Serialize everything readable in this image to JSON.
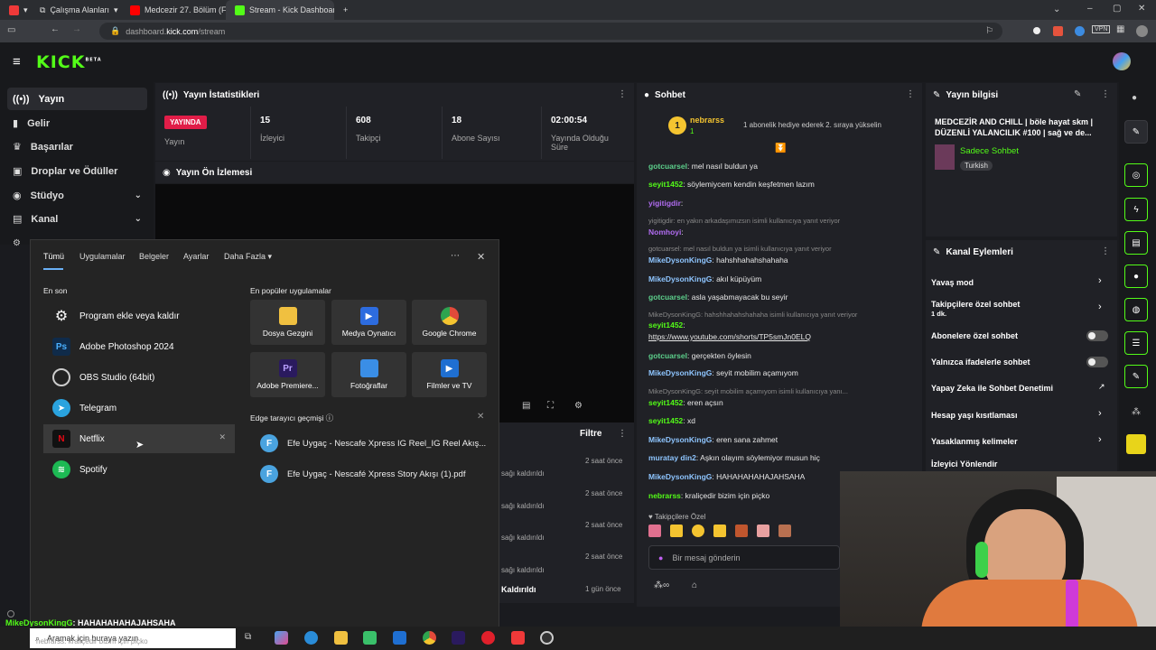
{
  "browser": {
    "tabs": [
      {
        "label": "Çalışma Alanları",
        "icon": "workspace-icon"
      },
      {
        "label": "Medcezir 27. Bölüm (FULL H",
        "icon": "youtube-icon"
      },
      {
        "label": "Stream - Kick Dashboard",
        "icon": "kick-icon"
      }
    ],
    "url_prefix": "dashboard.",
    "url_domain": "kick.com",
    "url_path": "/stream"
  },
  "kick": {
    "logo": "KICK",
    "logo_badge": "BETA"
  },
  "sidebar": {
    "items": [
      {
        "label": "Yayın"
      },
      {
        "label": "Gelir"
      },
      {
        "label": "Başarılar"
      },
      {
        "label": "Droplar ve Ödüller"
      },
      {
        "label": "Stüdyo"
      },
      {
        "label": "Kanal"
      }
    ]
  },
  "stats": {
    "title": "Yayın İstatistikleri",
    "live_badge": "YAYINDA",
    "live_label": "Yayın",
    "viewers": "15",
    "viewers_label": "İzleyici",
    "followers": "608",
    "followers_label": "Takipçi",
    "subs": "18",
    "subs_label": "Abone Sayısı",
    "duration": "02:00:54",
    "duration_label": "Yayında Olduğu Süre"
  },
  "preview": {
    "title": "Yayın Ön İzlemesi"
  },
  "activity": {
    "filter": "Filtre",
    "rows": [
      {
        "text": "sağı kaldırıldı",
        "time": "2 saat önce"
      },
      {
        "text": "sağı kaldırıldı",
        "time": "2 saat önce"
      },
      {
        "text": "sağı kaldırıldı",
        "time": "2 saat önce"
      },
      {
        "text": "sağı kaldırıldı",
        "time": "2 saat önce"
      },
      {
        "text": "Kaldırıldı",
        "time": "1 gün önce"
      }
    ]
  },
  "chat": {
    "title": "Sohbet",
    "pinned_user": "nebrarss",
    "pinned_count": "1",
    "pinned_text": "1 abonelik hediye ederek 2. sıraya yükselin",
    "messages": [
      {
        "user": "gotcuarsel",
        "text": "mel nasıl buldun ya",
        "color": "#5ccf8b"
      },
      {
        "user": "seyit1452",
        "text": "söylemiycem kendin keşfetmen lazım",
        "color": "#53fc18"
      },
      {
        "user": "yigitigdir",
        "text": "",
        "color": "#b06cf0"
      },
      {
        "user": "",
        "text": "yigitigdir: en yakın arkadaşımızsın isimli kullanıcıya yanıt veriyor",
        "color": "#888"
      },
      {
        "user": "Nomhoyi",
        "text": "",
        "color": "#b06cf0"
      },
      {
        "user": "",
        "text": "gotcuarsel: mel nasıl buldun ya isimli kullanıcıya yanıt veriyor",
        "color": "#888"
      },
      {
        "user": "MikeDysonKingG",
        "text": "hahshhahahshahaha",
        "color": "#8ec5ff"
      },
      {
        "user": "MikeDysonKingG",
        "text": "akıl küpüyüm",
        "color": "#8ec5ff"
      },
      {
        "user": "gotcuarsel",
        "text": "asla yaşabmayacak bu seyir",
        "color": "#5ccf8b"
      },
      {
        "user": "",
        "text": "MikeDysonKingG: hahshhahahshahaha isimli kullanıcıya yanıt veriyor",
        "color": "#888"
      },
      {
        "user": "seyit1452",
        "text": "",
        "color": "#53fc18"
      },
      {
        "user": "",
        "text": "https://www.youtube.com/shorts/TP5smJn0ELQ",
        "color": "#e8e8e8"
      },
      {
        "user": "gotcuarsel",
        "text": "gerçekten öylesin",
        "color": "#5ccf8b"
      },
      {
        "user": "MikeDysonKingG",
        "text": "seyit mobilim açamıyom",
        "color": "#8ec5ff"
      },
      {
        "user": "",
        "text": "MikeDysonKingG: seyit mobilim açamıyom isimli kullanıcıya yanı...",
        "color": "#888"
      },
      {
        "user": "seyit1452",
        "text": "eren açsın",
        "color": "#53fc18"
      },
      {
        "user": "seyit1452",
        "text": "xd",
        "color": "#53fc18"
      },
      {
        "user": "MikeDysonKingG",
        "text": "eren sana zahmet",
        "color": "#8ec5ff"
      },
      {
        "user": "muratay din2",
        "text": "Aşkın olayım söylemiyor musun hiç",
        "color": "#8ec5ff"
      },
      {
        "user": "MikeDysonKingG",
        "text": "HAHAHAHAHAJAHSAHA",
        "color": "#8ec5ff"
      },
      {
        "user": "nebrarss",
        "text": "kraliçedir bizim için piçko",
        "color": "#53fc18"
      }
    ],
    "followers_only": "Takipçilere Özel",
    "input_placeholder": "Bir mesaj gönderin"
  },
  "info": {
    "title": "Yayın bilgisi",
    "stream_title": "MEDCEZİR AND CHILL | böle hayat skm | DÜZENLİ YALANCILIK #100 | sağ ve de...",
    "category": "Sadece Sohbet",
    "language": "Turkish"
  },
  "channel_actions": {
    "title": "Kanal Eylemleri",
    "items": [
      {
        "label": "Yavaş mod",
        "sub": ""
      },
      {
        "label": "Takipçilere özel sohbet",
        "sub": "1 dk."
      },
      {
        "label": "Abonelere özel sohbet",
        "sub": ""
      },
      {
        "label": "Yalnızca ifadelerle sohbet",
        "sub": ""
      },
      {
        "label": "Yapay Zeka ile Sohbet Denetimi",
        "sub": ""
      },
      {
        "label": "Hesap yaşı kısıtlaması",
        "sub": ""
      },
      {
        "label": "Yasaklanmış kelimeler",
        "sub": ""
      },
      {
        "label": "İzleyici Yönlendir",
        "sub": ""
      }
    ]
  },
  "startmenu": {
    "tabs": [
      "Tümü",
      "Uygulamalar",
      "Belgeler",
      "Ayarlar",
      "Daha Fazla"
    ],
    "recent_title": "En son",
    "recent": [
      {
        "label": "Program ekle veya kaldır",
        "icon": "gear-icon",
        "color": "#444"
      },
      {
        "label": "Adobe Photoshop 2024",
        "icon": "photoshop-icon",
        "color": "#0f2b4a"
      },
      {
        "label": "OBS Studio (64bit)",
        "icon": "obs-icon",
        "color": "#333"
      },
      {
        "label": "Telegram",
        "icon": "telegram-icon",
        "color": "#2aa3df"
      },
      {
        "label": "Netflix",
        "icon": "netflix-icon",
        "color": "#b0060f"
      },
      {
        "label": "Spotify",
        "icon": "spotify-icon",
        "color": "#1db954"
      }
    ],
    "popular_title": "En popüler uygulamalar",
    "popular": [
      {
        "label": "Dosya Gezgini",
        "icon": "folder-icon",
        "color": "#f0c040"
      },
      {
        "label": "Medya Oynatıcı",
        "icon": "media-player-icon",
        "color": "#2d6cdf"
      },
      {
        "label": "Google Chrome",
        "icon": "chrome-icon",
        "color": "#e24a3a"
      },
      {
        "label": "Adobe Premiere...",
        "icon": "premiere-icon",
        "color": "#2a1a5e"
      },
      {
        "label": "Fotoğraflar",
        "icon": "photos-icon",
        "color": "#3a8ee6"
      },
      {
        "label": "Filmler ve TV",
        "icon": "movies-tv-icon",
        "color": "#1f6fd1"
      }
    ],
    "history_title": "Edge tarayıcı geçmişi",
    "history": [
      {
        "label": "Efe Uygaç - Nescafe Xpress IG Reel_IG Reel Akış..."
      },
      {
        "label": "Efe Uygaç - Nescafé Xpress Story Akışı (1).pdf"
      }
    ]
  },
  "taskbar": {
    "search_placeholder": "Aramak için buraya yazın",
    "overlay_user": "MikeDysonKingG",
    "overlay_text": "HAHAHAHAHAJAHSAHA",
    "overlay2": "nebrarss: kraliçedir bizim için piçko"
  }
}
